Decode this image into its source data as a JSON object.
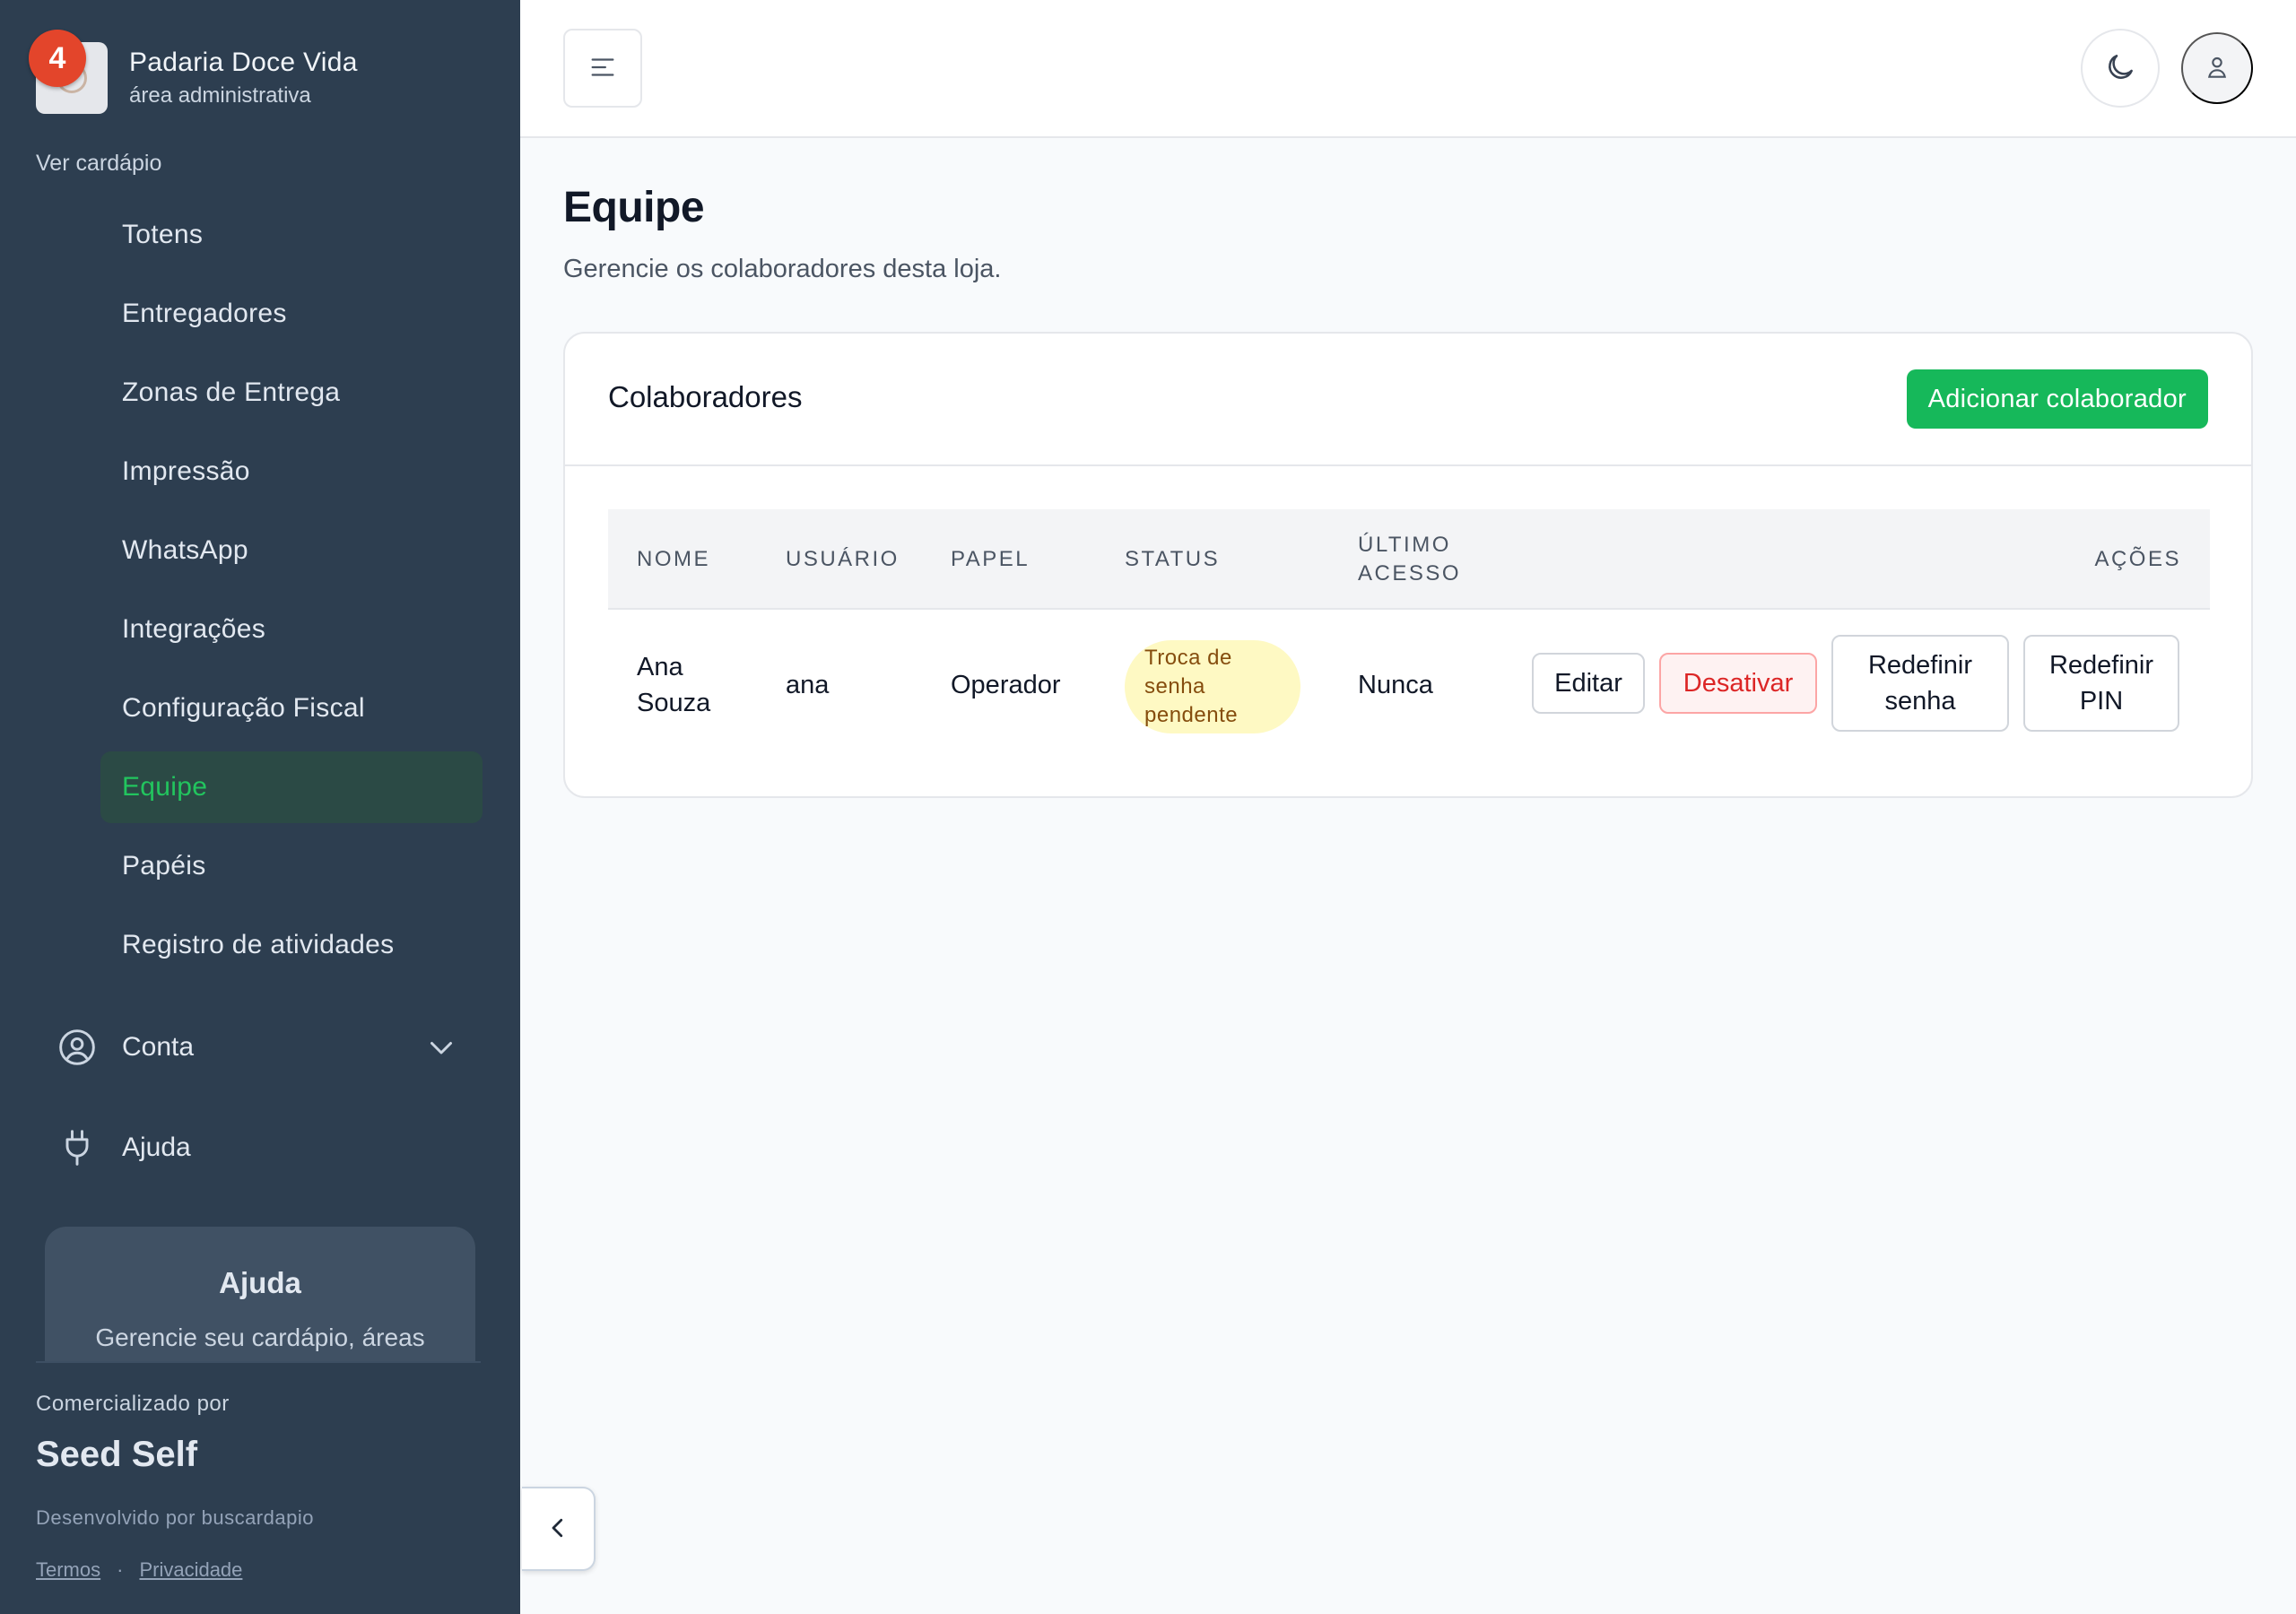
{
  "brand": {
    "name": "Padaria Doce Vida",
    "subtitle": "área administrativa",
    "notification_count": "4"
  },
  "sidebar": {
    "view_menu": "Ver cardápio",
    "items": [
      {
        "label": "Totens"
      },
      {
        "label": "Entregadores"
      },
      {
        "label": "Zonas de Entrega"
      },
      {
        "label": "Impressão"
      },
      {
        "label": "WhatsApp"
      },
      {
        "label": "Integrações"
      },
      {
        "label": "Configuração Fiscal"
      },
      {
        "label": "Equipe",
        "active": true
      },
      {
        "label": "Papéis"
      },
      {
        "label": "Registro de atividades"
      }
    ],
    "account_label": "Conta",
    "help_label": "Ajuda",
    "help_card": {
      "title": "Ajuda",
      "description": "Gerencie seu cardápio, áreas"
    },
    "powered_label": "Comercializado por",
    "powered_brand": "Seed Self",
    "developed_label": "Desenvolvido por buscardapio",
    "terms": "Termos",
    "legal_sep": "·",
    "privacy": "Privacidade"
  },
  "icons": {
    "menu": "hamburger-icon",
    "theme": "moon-icon",
    "user": "user-icon",
    "account": "user-circle-icon",
    "help": "plug-icon",
    "chevron": "chevron-down-icon",
    "collapse": "chevron-left-icon"
  },
  "page": {
    "title": "Equipe",
    "subtitle": "Gerencie os colaboradores desta loja."
  },
  "card": {
    "title": "Colaboradores",
    "add_button": "Adicionar colaborador",
    "columns": {
      "name": "NOME",
      "user": "USUÁRIO",
      "role": "PAPEL",
      "status": "STATUS",
      "last_access_1": "ÚLTIMO",
      "last_access_2": "ACESSO",
      "actions": "AÇÕES"
    },
    "rows": [
      {
        "name_1": "Ana",
        "name_2": "Souza",
        "user": "ana",
        "role": "Operador",
        "status_1": "Troca de",
        "status_2": "senha",
        "status_3": "pendente",
        "last_access": "Nunca",
        "edit": "Editar",
        "deactivate": "Desativar",
        "reset_password_1": "Redefinir",
        "reset_password_2": "senha",
        "reset_pin_1": "Redefinir",
        "reset_pin_2": "PIN"
      }
    ]
  },
  "colors": {
    "sidebar_bg": "#2d3e50",
    "accent": "#16b85a",
    "danger": "#dc2626",
    "pending": "#fef9c3"
  }
}
